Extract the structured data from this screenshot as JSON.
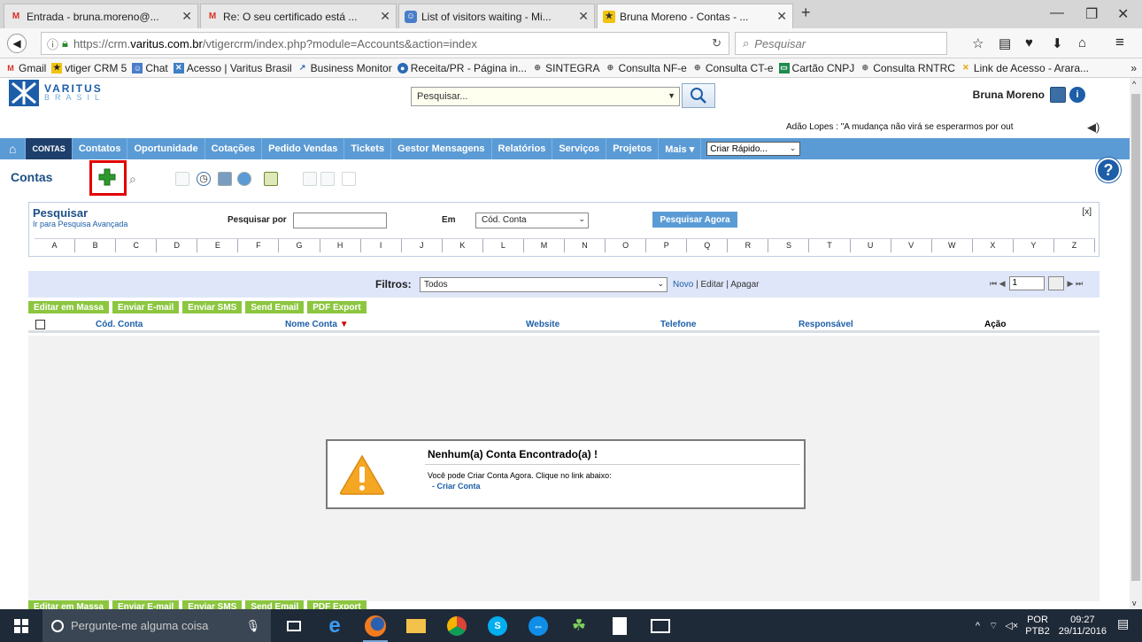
{
  "browser": {
    "tabs": [
      {
        "title": "Entrada - bruna.moreno@...",
        "icon": "gmail-icon",
        "active": false
      },
      {
        "title": "Re: O seu certificado está ...",
        "icon": "gmail-icon",
        "active": false
      },
      {
        "title": "List of visitors waiting - Mi...",
        "icon": "chat-icon",
        "active": false
      },
      {
        "title": "Bruna Moreno - Contas - ...",
        "icon": "vtiger-icon",
        "active": true
      }
    ],
    "new_tab": "+",
    "url_prefix": "https://crm.",
    "url_domain": "varitus.com.br",
    "url_rest": "/vtigercrm/index.php?module=Accounts&action=index",
    "search_placeholder": "Pesquisar",
    "bookmarks": [
      {
        "label": "Gmail",
        "icon": "gmail-icon"
      },
      {
        "label": "vtiger CRM 5",
        "icon": "vtiger-icon"
      },
      {
        "label": "Chat",
        "icon": "chat-icon"
      },
      {
        "label": "Acesso | Varitus Brasil",
        "icon": "varitus-icon"
      },
      {
        "label": "Business Monitor",
        "icon": "chart-icon"
      },
      {
        "label": "Receita/PR - Página in...",
        "icon": "globe-icon"
      },
      {
        "label": "SINTEGRA",
        "icon": "globe-icon"
      },
      {
        "label": "Consulta NF-e",
        "icon": "globe-icon"
      },
      {
        "label": "Consulta CT-e",
        "icon": "globe-icon"
      },
      {
        "label": "Cartão CNPJ",
        "icon": "card-icon"
      },
      {
        "label": "Consulta RNTRC",
        "icon": "globe-icon"
      },
      {
        "label": "Link de Acesso - Arara...",
        "icon": "varitus-icon"
      }
    ],
    "bookmarks_more": "»"
  },
  "crm": {
    "logo_top": "VARITUS",
    "logo_bottom": "BRASIL",
    "top_search": "Pesquisar...",
    "user_name": "Bruna Moreno",
    "quote": "Adão Lopes : \"A mudança não virá se esperarmos por out",
    "menu": [
      "CONTAS",
      "Contatos",
      "Oportunidade",
      "Cotações",
      "Pedido Vendas",
      "Tickets",
      "Gestor Mensagens",
      "Relatórios",
      "Serviços",
      "Projetos",
      "Mais ▾"
    ],
    "quick_create": "Criar Rápido...",
    "page_title": "Contas",
    "search": {
      "title": "Pesquisar",
      "advanced_link": "Ir para Pesquisa Avançada",
      "search_by_label": "Pesquisar por",
      "in_label": "Em",
      "field_value": "Cód. Conta",
      "button": "Pesquisar Agora",
      "close": "[x]",
      "alphabet": [
        "A",
        "B",
        "C",
        "D",
        "E",
        "F",
        "G",
        "H",
        "I",
        "J",
        "K",
        "L",
        "M",
        "N",
        "O",
        "P",
        "Q",
        "R",
        "S",
        "T",
        "U",
        "V",
        "W",
        "X",
        "Y",
        "Z"
      ]
    },
    "filter": {
      "label": "Filtros:",
      "value": "Todos",
      "new": "Novo",
      "edit": "Editar",
      "delete": "Apagar",
      "page": "1"
    },
    "actions": [
      "Editar em Massa",
      "Enviar E-mail",
      "Enviar SMS",
      "Send Email",
      "PDF Export"
    ],
    "columns": [
      "Cód. Conta",
      "Nome Conta",
      "Website",
      "Telefone",
      "Responsável",
      "Ação"
    ],
    "empty": {
      "title": "Nenhum(a) Conta Encontrado(a) !",
      "subtitle": "Você pode Criar Conta Agora. Clique no link abaixo:",
      "link": "- Criar Conta"
    }
  },
  "taskbar": {
    "search_placeholder": "Pergunte-me alguma coisa",
    "language": "POR",
    "language_sub": "PTB2",
    "time": "09:27",
    "date": "29/11/2016"
  },
  "colors": {
    "menu": "#5b9bd5",
    "menu_active": "#1e3f6b",
    "action_green": "#8cc63f",
    "filter_bg": "#dfe6f9",
    "highlight": "#e00000"
  }
}
